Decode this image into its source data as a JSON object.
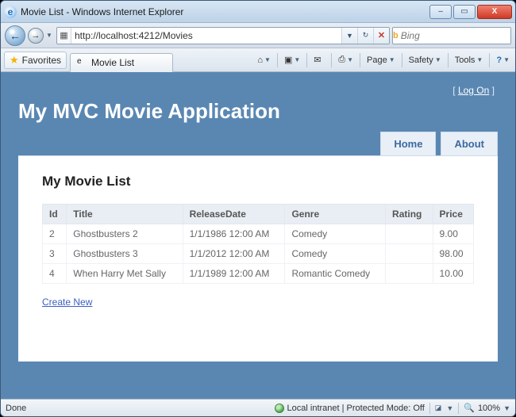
{
  "window": {
    "title": "Movie List - Windows Internet Explorer",
    "min_label": "–",
    "max_label": "▭",
    "close_label": "X"
  },
  "nav": {
    "back_glyph": "←",
    "fwd_glyph": "→",
    "url_scheme": "http://",
    "url_host": "localhost",
    "url_rest": ":4212/Movies",
    "url_full": "http://localhost:4212/Movies",
    "refresh_glyph": "↻",
    "stop_glyph": "✕"
  },
  "search": {
    "provider_glyph": "b",
    "placeholder": "Bing",
    "go_glyph": "🔍"
  },
  "favbar": {
    "favorites_label": "Favorites",
    "tab_label": "Movie List"
  },
  "cmd": {
    "home_glyph": "⌂",
    "feed_glyph": "▣",
    "mail_glyph": "✉",
    "print_glyph": "⎙",
    "page_label": "Page",
    "safety_label": "Safety",
    "tools_label": "Tools",
    "help_glyph": "?"
  },
  "app": {
    "logon_prefix": "[ ",
    "logon_label": "Log On",
    "logon_suffix": " ]",
    "heading": "My MVC Movie Application",
    "tab_home": "Home",
    "tab_about": "About",
    "page_title": "My Movie List",
    "create_label": "Create New",
    "columns": {
      "id": "Id",
      "title": "Title",
      "release": "ReleaseDate",
      "genre": "Genre",
      "rating": "Rating",
      "price": "Price"
    },
    "rows": [
      {
        "id": "2",
        "title": "Ghostbusters 2",
        "release": "1/1/1986 12:00 AM",
        "genre": "Comedy",
        "rating": "",
        "price": "9.00"
      },
      {
        "id": "3",
        "title": "Ghostbusters 3",
        "release": "1/1/2012 12:00 AM",
        "genre": "Comedy",
        "rating": "",
        "price": "98.00"
      },
      {
        "id": "4",
        "title": "When Harry Met Sally",
        "release": "1/1/1989 12:00 AM",
        "genre": "Romantic Comedy",
        "rating": "",
        "price": "10.00"
      }
    ]
  },
  "status": {
    "left": "Done",
    "zone": "Local intranet | Protected Mode: Off",
    "zoom": "100%"
  }
}
